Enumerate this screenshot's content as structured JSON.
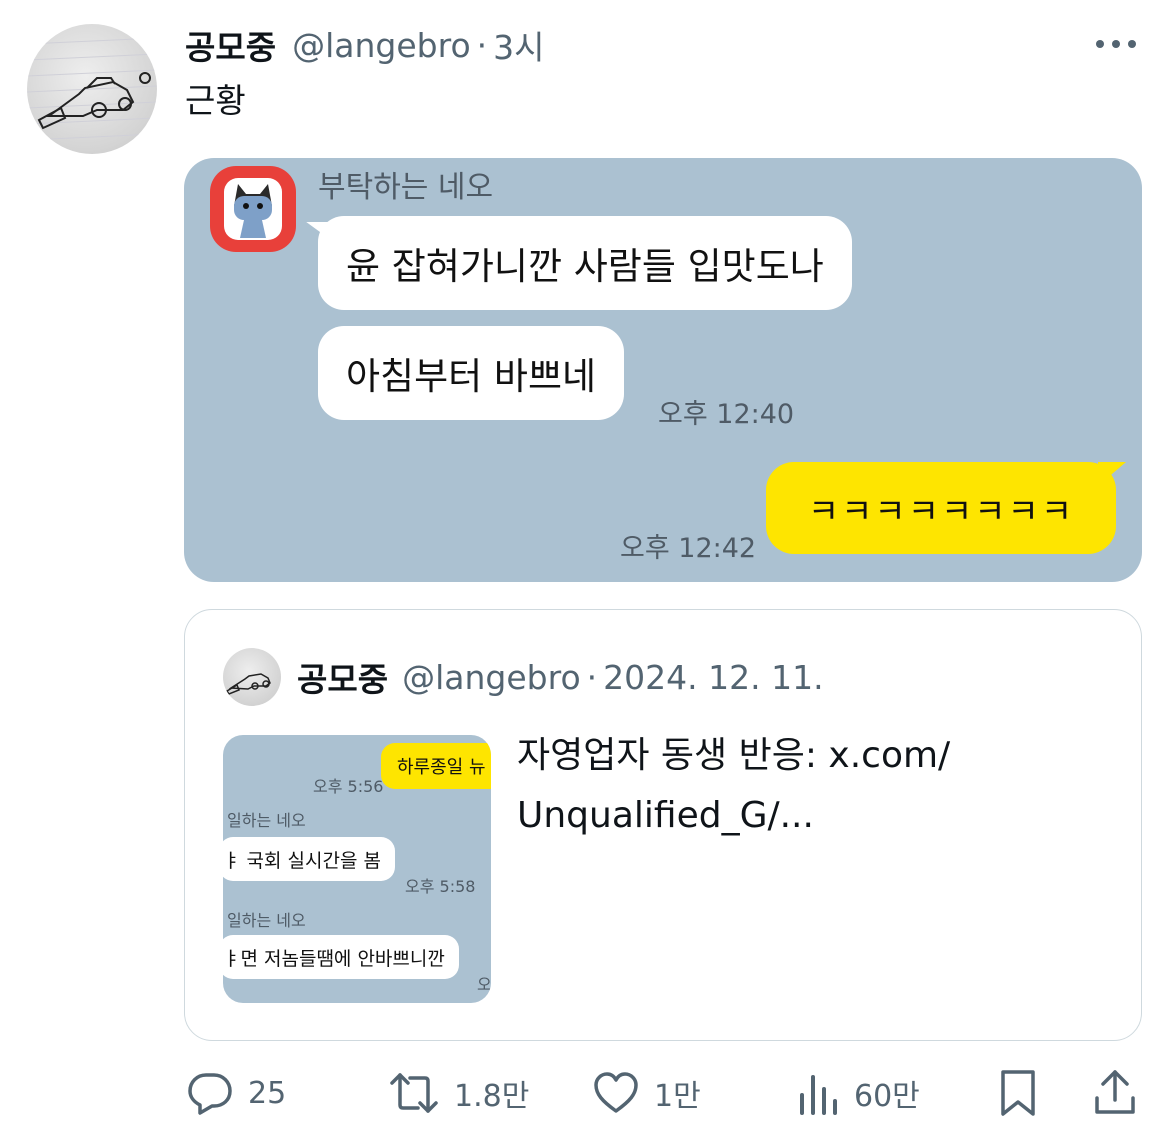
{
  "tweet": {
    "author_name": "공모중",
    "author_handle": "@langebro",
    "separator": "·",
    "time": "3시",
    "text": "근황",
    "avatar_caption": "공모중"
  },
  "chat_image": {
    "sender": "부탁하는 네오",
    "messages_in": [
      "윤 잡혀가니깐 사람들 입맛도나",
      "아침부터 바쁘네"
    ],
    "time_in": "오후 12:40",
    "message_out": "ㅋㅋㅋㅋㅋㅋㅋㅋ",
    "time_out": "오후 12:42"
  },
  "quote": {
    "author_name": "공모중",
    "author_handle": "@langebro",
    "separator": "·",
    "date": "2024. 12. 11.",
    "text_line1": "자영업자 동생 반응: x.com/",
    "text_line2": "Unqualified_G/...",
    "thumb": {
      "yellow": "하루종일 뉴",
      "time1": "오후 5:56",
      "sender1": "일하는 네오",
      "msg1": "ㅑ 국회 실시간을 봄",
      "time2": "오후 5:58",
      "sender2": "일하는 네오",
      "msg2": "ㅑ면 저놈들땜에 안바쁘니깐",
      "trail": "오"
    }
  },
  "actions": {
    "reply_count": "25",
    "retweet_count": "1.8만",
    "like_count": "1만",
    "view_count": "60만",
    "icons": [
      "reply-icon",
      "retweet-icon",
      "like-icon",
      "views-icon",
      "bookmark-icon",
      "share-icon"
    ]
  },
  "colors": {
    "chat_bg": "#abc1d1",
    "bubble_yellow": "#fee500",
    "secondary_text": "#536471",
    "border": "#cfd9de"
  }
}
